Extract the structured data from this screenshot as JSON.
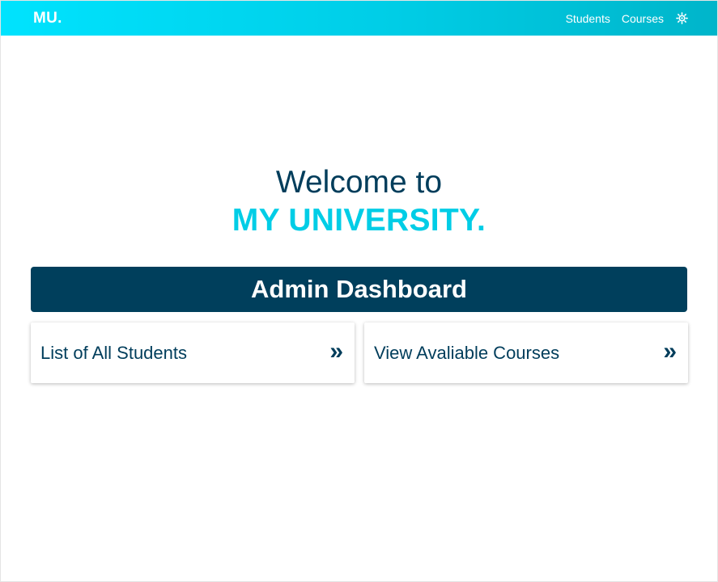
{
  "navbar": {
    "brand": "MU.",
    "links": [
      {
        "label": "Students"
      },
      {
        "label": "Courses"
      }
    ],
    "theme_icon": "sun-icon"
  },
  "hero": {
    "welcome": "Welcome to",
    "university": "MY UNIVERSITY."
  },
  "dashboard": {
    "title": "Admin Dashboard",
    "cards": [
      {
        "label": "List of All Students",
        "arrow": "»",
        "icon": "double-chevron-right-icon"
      },
      {
        "label": "View Avaliable Courses",
        "arrow": "»",
        "icon": "double-chevron-right-icon"
      }
    ]
  },
  "colors": {
    "navbar_gradient_start": "#00e3fe",
    "navbar_gradient_end": "#00b5ca",
    "primary_dark": "#003f5c",
    "accent_cyan": "#00cde6"
  }
}
